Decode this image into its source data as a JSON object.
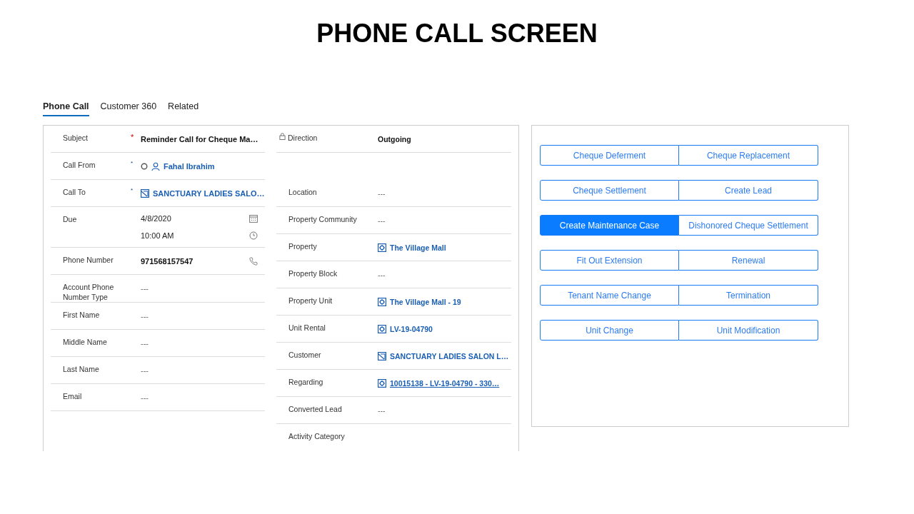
{
  "slide_title": "PHONE CALL SCREEN",
  "tabs": [
    {
      "label": "Phone Call",
      "selected": true
    },
    {
      "label": "Customer 360",
      "selected": false
    },
    {
      "label": "Related",
      "selected": false
    }
  ],
  "form": {
    "left_fields": [
      {
        "label": "Subject",
        "mark": "*",
        "mark_required": true,
        "values": [
          {
            "text": "Reminder Call for Cheque Ma…",
            "kind": "plain"
          }
        ]
      },
      {
        "label": "Call From",
        "mark": "*",
        "mark_required": false,
        "values": [
          {
            "text": "Fahal Ibrahim",
            "kind": "user"
          }
        ]
      },
      {
        "label": "Call To",
        "mark": "*",
        "mark_required": false,
        "values": [
          {
            "text": "SANCTUARY LADIES SALO…",
            "kind": "account"
          }
        ]
      },
      {
        "label": "Due",
        "values": [
          {
            "text": "4/8/2020",
            "kind": "date"
          },
          {
            "text": "10:00 AM",
            "kind": "time"
          }
        ]
      },
      {
        "label": "Phone Number",
        "values": [
          {
            "text": "971568157547",
            "kind": "phone"
          }
        ]
      },
      {
        "label": "Account Phone Number Type",
        "values": [
          {
            "text": "---",
            "kind": "empty"
          }
        ]
      },
      {
        "label": "First Name",
        "values": [
          {
            "text": "---",
            "kind": "empty"
          }
        ]
      },
      {
        "label": "Middle Name",
        "values": [
          {
            "text": "---",
            "kind": "empty"
          }
        ]
      },
      {
        "label": "Last Name",
        "values": [
          {
            "text": "---",
            "kind": "empty"
          }
        ]
      },
      {
        "label": "Email",
        "values": [
          {
            "text": "---",
            "kind": "empty"
          }
        ]
      }
    ],
    "right_fields": [
      {
        "label": "Direction",
        "locked": true,
        "values": [
          {
            "text": "Outgoing",
            "kind": "plain"
          }
        ]
      },
      {
        "label": "Location",
        "values": [
          {
            "text": "---",
            "kind": "empty"
          }
        ]
      },
      {
        "label": "Property Community",
        "values": [
          {
            "text": "---",
            "kind": "empty"
          }
        ]
      },
      {
        "label": "Property",
        "values": [
          {
            "text": "The Village Mall",
            "kind": "record"
          }
        ]
      },
      {
        "label": "Property Block",
        "values": [
          {
            "text": "---",
            "kind": "empty"
          }
        ]
      },
      {
        "label": "Property Unit",
        "values": [
          {
            "text": "The Village Mall - 19",
            "kind": "record"
          }
        ]
      },
      {
        "label": "Unit Rental",
        "values": [
          {
            "text": "LV-19-04790",
            "kind": "record"
          }
        ]
      },
      {
        "label": "Customer",
        "values": [
          {
            "text": "SANCTUARY LADIES SALON L…",
            "kind": "account"
          }
        ]
      },
      {
        "label": "Regarding",
        "values": [
          {
            "text": "10015138 - LV-19-04790 - 330…",
            "kind": "record-link"
          }
        ]
      },
      {
        "label": "Converted Lead",
        "values": [
          {
            "text": "---",
            "kind": "empty"
          }
        ]
      },
      {
        "label": "Activity Category"
      }
    ]
  },
  "actions": [
    {
      "label": "Cheque Deferment",
      "selected": false
    },
    {
      "label": "Cheque Replacement",
      "selected": false
    },
    {
      "label": "Cheque Settlement",
      "selected": false
    },
    {
      "label": "Create Lead",
      "selected": false
    },
    {
      "label": "Create Maintenance Case",
      "selected": true
    },
    {
      "label": "Dishonored Cheque Settlement",
      "selected": false
    },
    {
      "label": "Fit Out Extension",
      "selected": false
    },
    {
      "label": "Renewal",
      "selected": false
    },
    {
      "label": "Tenant Name Change",
      "selected": false
    },
    {
      "label": "Termination",
      "selected": false
    },
    {
      "label": "Unit Change",
      "selected": false
    },
    {
      "label": "Unit Modification",
      "selected": false
    }
  ]
}
